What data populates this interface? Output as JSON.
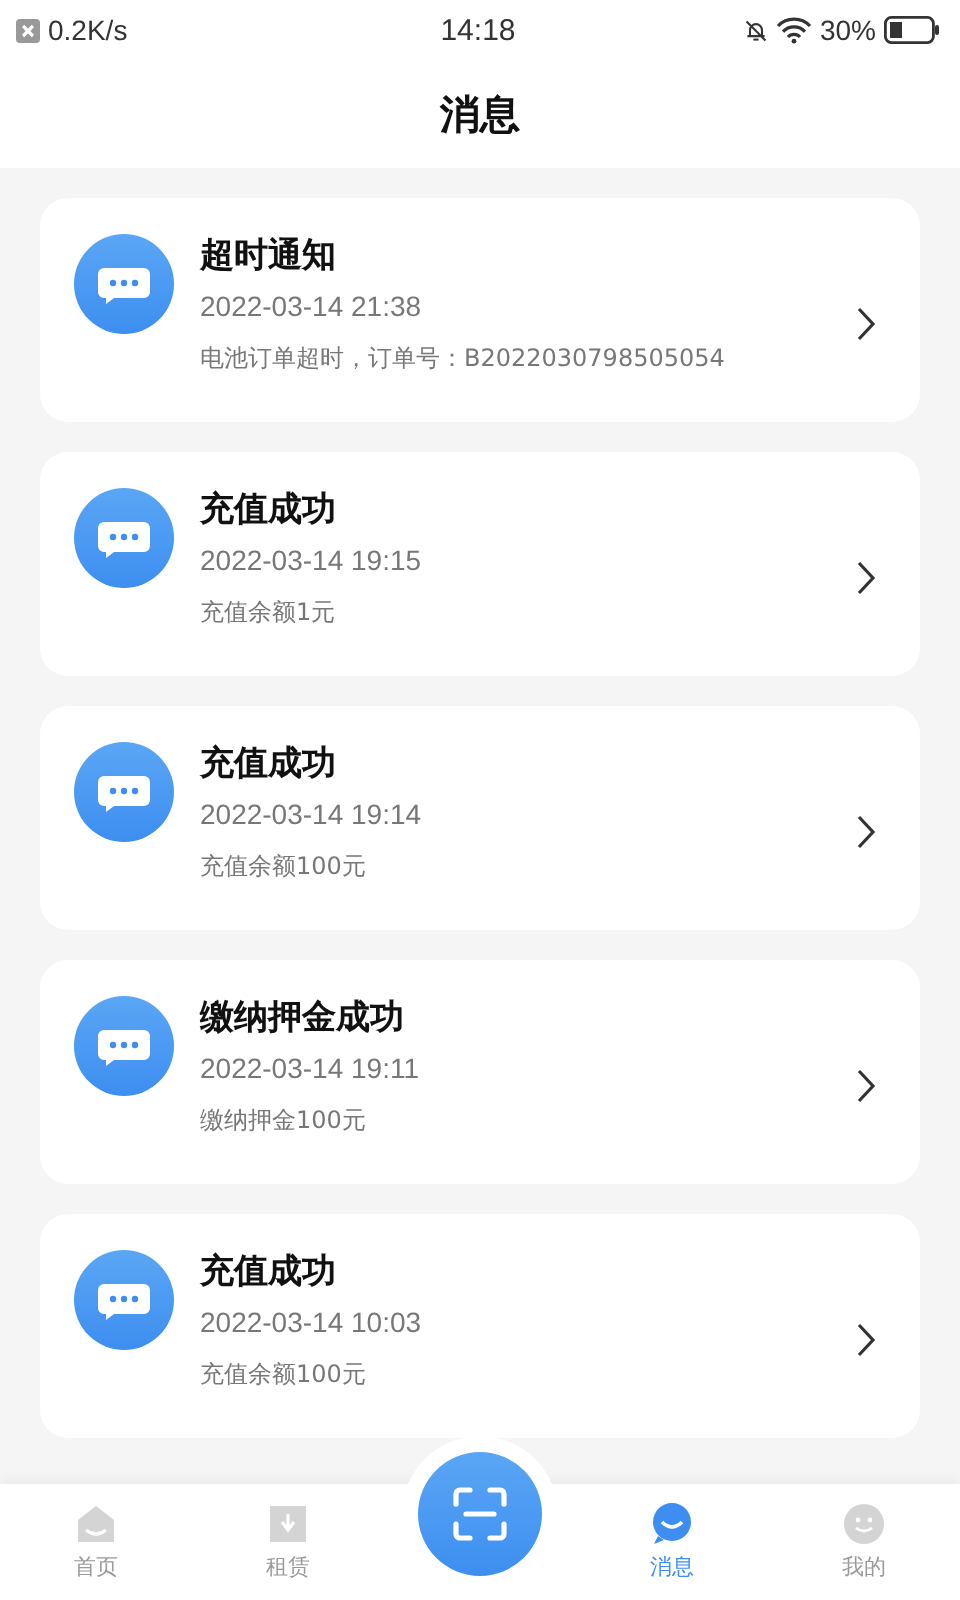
{
  "status_bar": {
    "speed": "0.2K/s",
    "time": "14:18",
    "battery": "30%"
  },
  "header": {
    "title": "消息"
  },
  "messages": [
    {
      "title": "超时通知",
      "time": "2022-03-14 21:38",
      "text": "电池订单超时，订单号：B2022030798505054"
    },
    {
      "title": "充值成功",
      "time": "2022-03-14 19:15",
      "text": "充值余额1元"
    },
    {
      "title": "充值成功",
      "time": "2022-03-14 19:14",
      "text": "充值余额100元"
    },
    {
      "title": "缴纳押金成功",
      "time": "2022-03-14 19:11",
      "text": "缴纳押金100元"
    },
    {
      "title": "充值成功",
      "time": "2022-03-14 10:03",
      "text": "充值余额100元"
    }
  ],
  "tab_bar": [
    {
      "kind": "home",
      "label": "首页",
      "selected": false
    },
    {
      "kind": "rent",
      "label": "租赁",
      "selected": false
    },
    {
      "kind": "scan"
    },
    {
      "kind": "message",
      "label": "消息",
      "selected": true
    },
    {
      "kind": "mine",
      "label": "我的",
      "selected": false
    }
  ]
}
